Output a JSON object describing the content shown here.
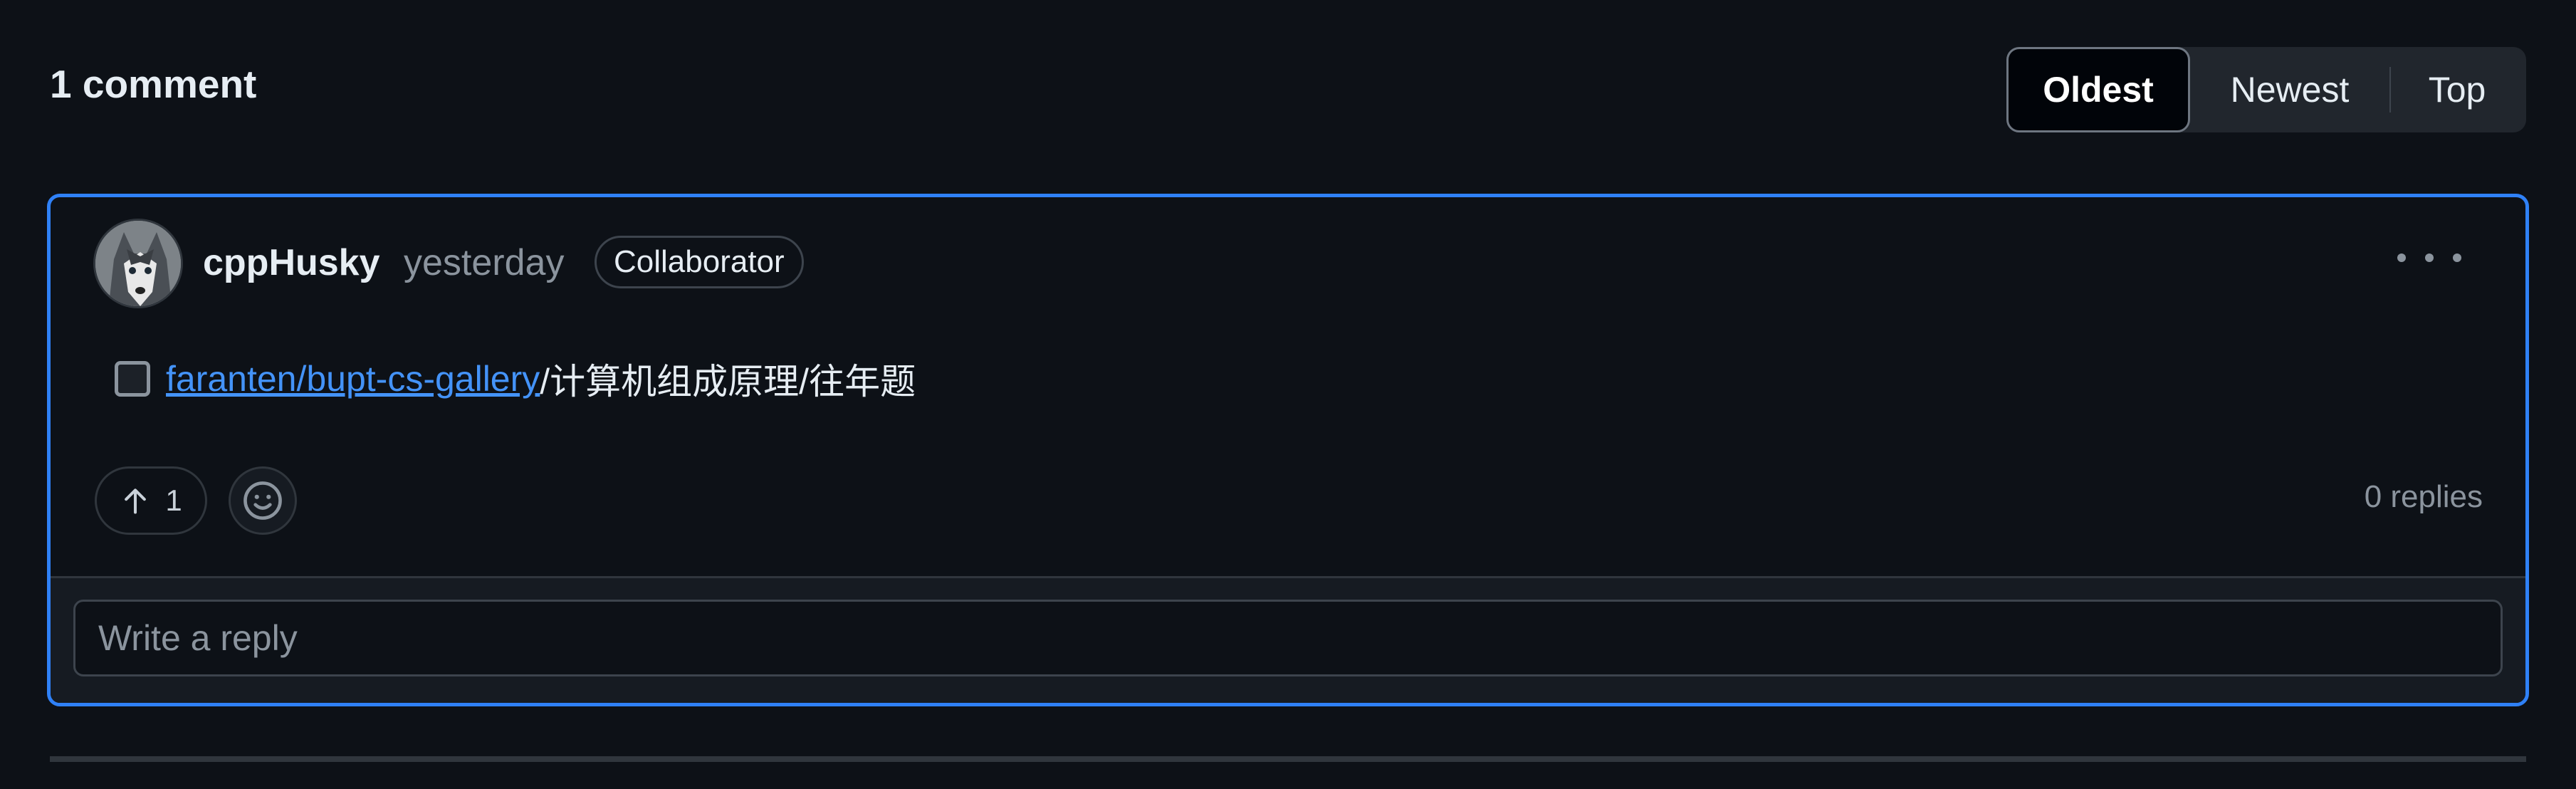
{
  "header": {
    "comment_count": "1 comment",
    "sort_options": [
      "Oldest",
      "Newest",
      "Top"
    ],
    "selected_sort": "Oldest"
  },
  "comment": {
    "author": "cppHusky",
    "timestamp": "yesterday",
    "role": "Collaborator",
    "task": {
      "checked": false,
      "link_text": "faranten/bupt-cs-gallery",
      "path_rest": "/计算机组成原理/往年题"
    },
    "upvotes": "1",
    "replies": "0 replies"
  },
  "reply": {
    "placeholder": "Write a reply"
  },
  "icons": {
    "more": "kebab-horizontal-icon",
    "upvote": "arrow-up-icon",
    "reaction": "smiley-icon"
  },
  "colors": {
    "background": "#0d1117",
    "accent": "#2f81f7",
    "link": "#4493f8"
  }
}
